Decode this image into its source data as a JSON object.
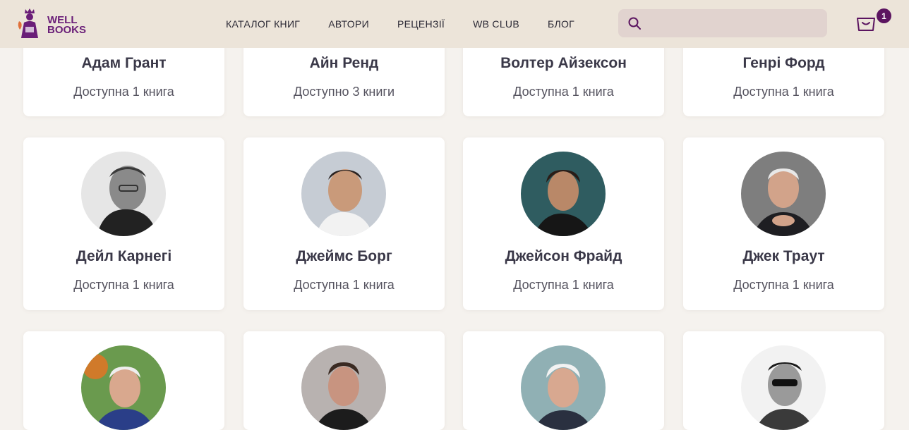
{
  "header": {
    "logo_line1": "WELL",
    "logo_line2": "BOOKS",
    "nav": [
      "КАТАЛОГ КНИГ",
      "АВТОРИ",
      "РЕЦЕНЗІЇ",
      "WB CLUB",
      "БЛОГ"
    ],
    "search_placeholder": "",
    "cart_count": "1"
  },
  "colors": {
    "brand": "#6a1e78",
    "header_bg": "#ece4d9",
    "search_bg": "#e1d3cf",
    "badge": "#5b1460"
  },
  "authors_row1": [
    {
      "name": "Адам Грант",
      "books": "Доступна 1 книга"
    },
    {
      "name": "Айн Ренд",
      "books": "Доступно 3 книги"
    },
    {
      "name": "Волтер Айзексон",
      "books": "Доступна 1 книга"
    },
    {
      "name": "Генрі Форд",
      "books": "Доступна 1 книга"
    }
  ],
  "authors_row2": [
    {
      "name": "Дейл Карнегі",
      "books": "Доступна 1 книга",
      "photo": "bw-portrait"
    },
    {
      "name": "Джеймс Борг",
      "books": "Доступна 1 книга",
      "photo": "color-portrait"
    },
    {
      "name": "Джейсон Фрайд",
      "books": "Доступна 1 книга",
      "photo": "color-portrait"
    },
    {
      "name": "Джек Траут",
      "books": "Доступна 1 книга",
      "photo": "color-portrait"
    }
  ],
  "authors_row3": [
    {
      "photo": "color-portrait"
    },
    {
      "photo": "color-portrait"
    },
    {
      "photo": "color-portrait"
    },
    {
      "photo": "bw-portrait"
    }
  ]
}
